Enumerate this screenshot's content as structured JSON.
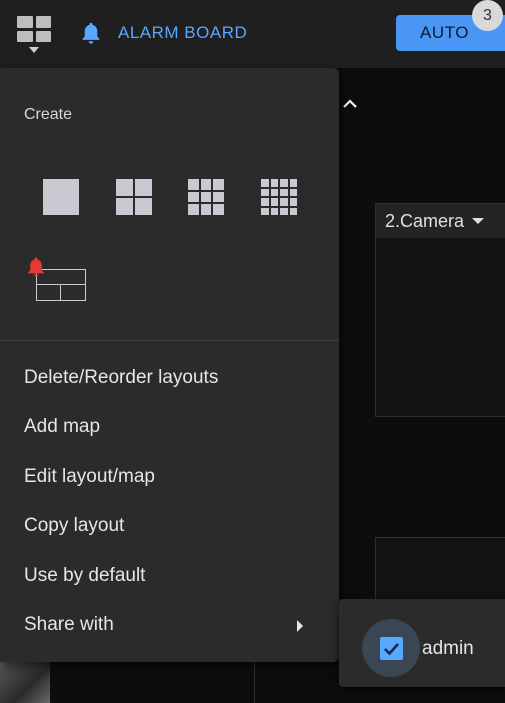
{
  "topbar": {
    "alarm_board_label": "ALARM BOARD",
    "mode_button_label": "AUTO",
    "mode_badge_count": "3",
    "alarm_color": "#5aa7ff",
    "accent_color": "#4a96f5"
  },
  "camera": {
    "title": "2.Camera"
  },
  "menu": {
    "create_title": "Create",
    "create_options": [
      {
        "icon": "layout-1x1-icon"
      },
      {
        "icon": "layout-2x2-icon"
      },
      {
        "icon": "layout-3x3-icon"
      },
      {
        "icon": "layout-4x4-icon"
      },
      {
        "icon": "alarm-layout-icon"
      }
    ],
    "items": [
      {
        "label": "Delete/Reorder layouts"
      },
      {
        "label": "Add map"
      },
      {
        "label": "Edit layout/map"
      },
      {
        "label": "Copy layout"
      },
      {
        "label": "Use by default"
      },
      {
        "label": "Share with"
      }
    ]
  },
  "share_with": {
    "users": [
      {
        "name": "admin",
        "checked": true
      }
    ]
  }
}
